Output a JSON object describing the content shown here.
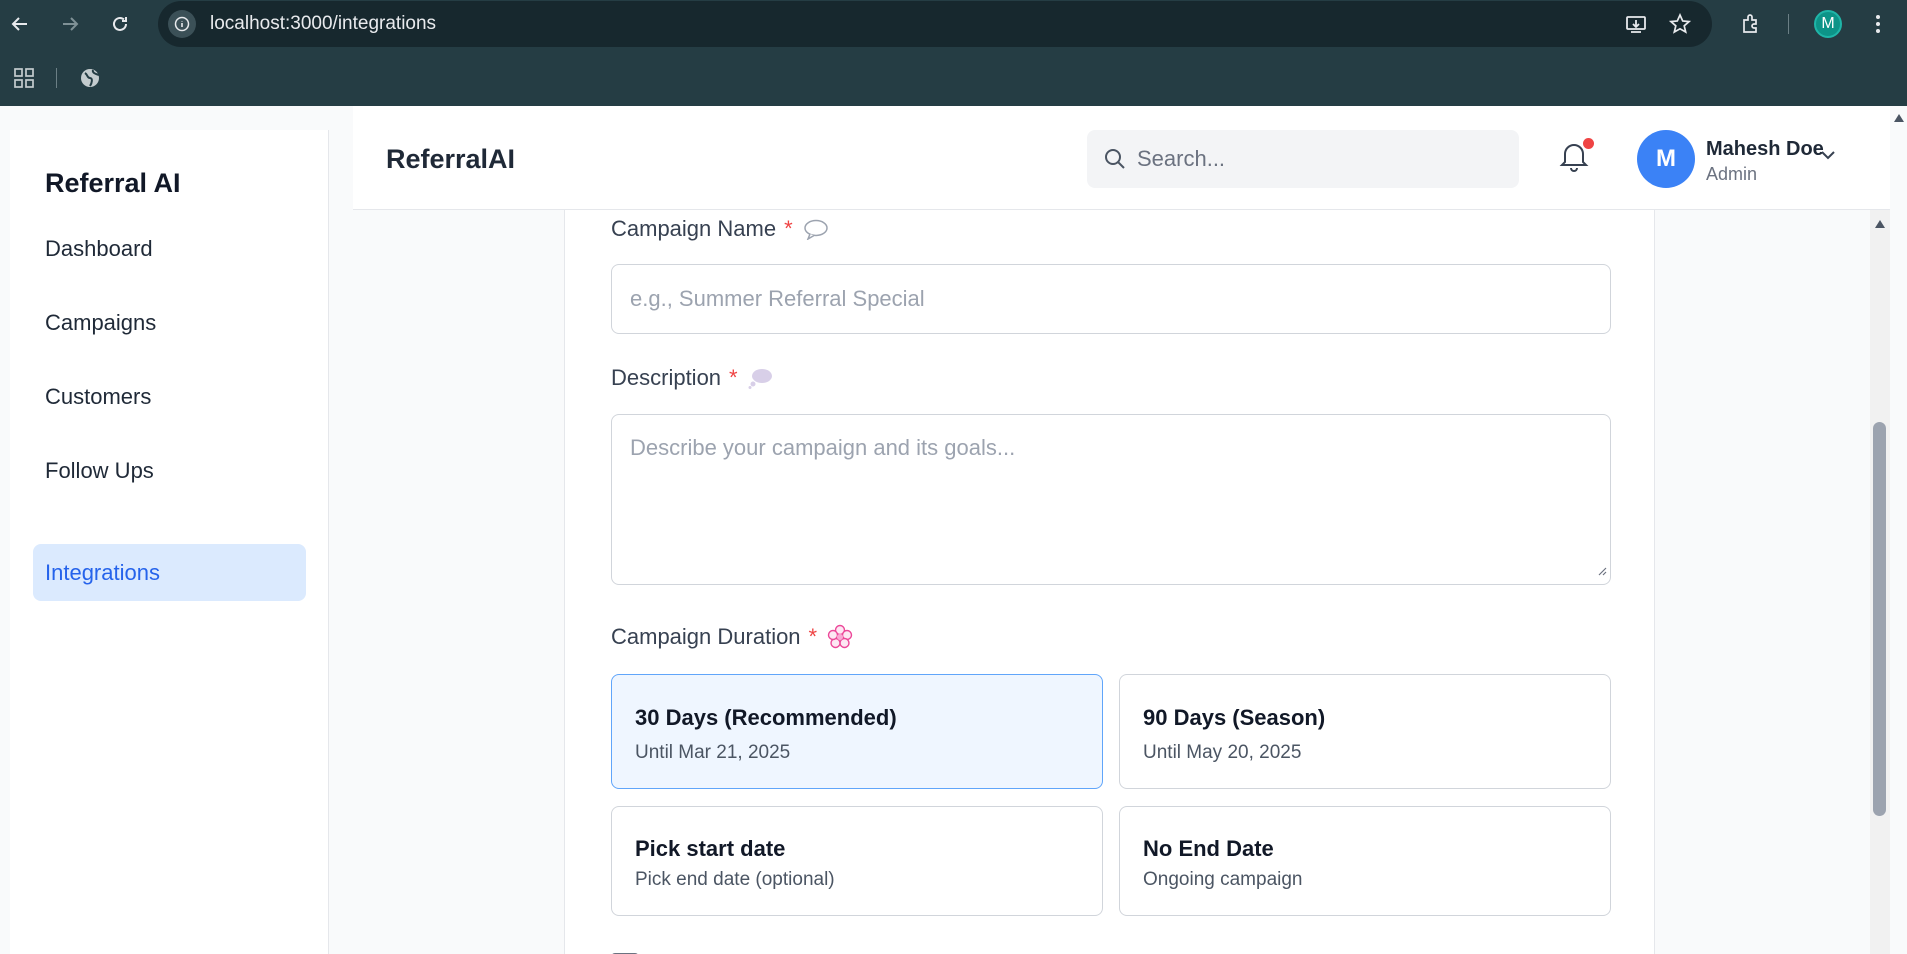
{
  "browser": {
    "url": "localhost:3000/integrations",
    "profile_initial": "M"
  },
  "sidebar": {
    "brand": "Referral AI",
    "items": [
      {
        "label": "Dashboard",
        "active": false
      },
      {
        "label": "Campaigns",
        "active": false
      },
      {
        "label": "Customers",
        "active": false
      },
      {
        "label": "Follow Ups",
        "active": false
      },
      {
        "label": "Integrations",
        "active": true
      }
    ]
  },
  "header": {
    "title": "ReferralAI",
    "search_placeholder": "Search...",
    "user": {
      "initial": "M",
      "name": "Mahesh Doe",
      "role": "Admin"
    }
  },
  "form": {
    "campaign_name": {
      "label": "Campaign Name",
      "required_mark": "*",
      "placeholder": "e.g., Summer Referral Special",
      "value": ""
    },
    "description": {
      "label": "Description",
      "required_mark": "*",
      "placeholder": "Describe your campaign and its goals...",
      "value": ""
    },
    "duration": {
      "label": "Campaign Duration",
      "required_mark": "*",
      "options": [
        {
          "title": "30 Days (Recommended)",
          "subtitle": "Until Mar 21, 2025",
          "selected": true
        },
        {
          "title": "90 Days (Season)",
          "subtitle": "Until May 20, 2025",
          "selected": false
        },
        {
          "title": "Pick start date",
          "subtitle": "Pick end date (optional)",
          "selected": false
        },
        {
          "title": "No End Date",
          "subtitle": "Ongoing campaign",
          "selected": false
        }
      ]
    }
  },
  "colors": {
    "chrome_bg": "#253d44",
    "accent": "#2563eb",
    "active_nav_bg": "#dbeafe",
    "avatar_bg": "#3b82f6",
    "required": "#ef4444"
  }
}
